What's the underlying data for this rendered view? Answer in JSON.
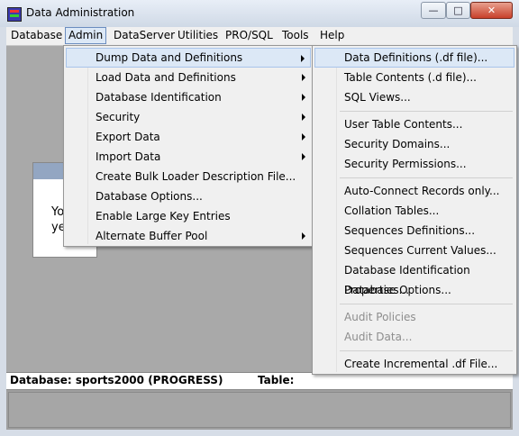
{
  "window": {
    "title": "Data Administration",
    "icon": "progress-app-icon",
    "min": "—",
    "max": "□",
    "close": "✕"
  },
  "menubar": {
    "items": [
      "Database",
      "Admin",
      "DataServer",
      "Utilities",
      "PRO/SQL",
      "Tools",
      "Help"
    ]
  },
  "background_dialog": {
    "line1": "Yo",
    "line2": "ye"
  },
  "admin_menu": {
    "items": [
      {
        "label": "Dump Data and Definitions",
        "submenu": true
      },
      {
        "label": "Load Data and Definitions",
        "submenu": true
      },
      {
        "label": "Database Identification",
        "submenu": true
      },
      {
        "label": "Security",
        "submenu": true
      },
      {
        "label": "Export Data",
        "submenu": true
      },
      {
        "label": "Import Data",
        "submenu": true
      },
      {
        "label": "Create Bulk Loader Description File...",
        "submenu": false
      },
      {
        "label": "Database Options...",
        "submenu": false
      },
      {
        "label": "Enable Large Key Entries",
        "submenu": false
      },
      {
        "label": "Alternate Buffer Pool",
        "submenu": true
      }
    ]
  },
  "dump_submenu": {
    "groups": [
      [
        "Data Definitions (.df file)...",
        "Table Contents (.d file)...",
        "SQL Views..."
      ],
      [
        "User Table Contents...",
        "Security Domains...",
        "Security Permissions..."
      ],
      [
        "Auto-Connect Records only...",
        "Collation Tables...",
        "Sequences Definitions...",
        "Sequences Current Values...",
        "Database Identification Properties...",
        "Database Options..."
      ],
      [
        "Audit Policies",
        "Audit Data..."
      ],
      [
        "Create Incremental .df File..."
      ]
    ],
    "disabled": [
      "Audit Policies",
      "Audit Data..."
    ]
  },
  "status": {
    "database": "Database: sports2000 (PROGRESS)",
    "table": "Table:"
  }
}
